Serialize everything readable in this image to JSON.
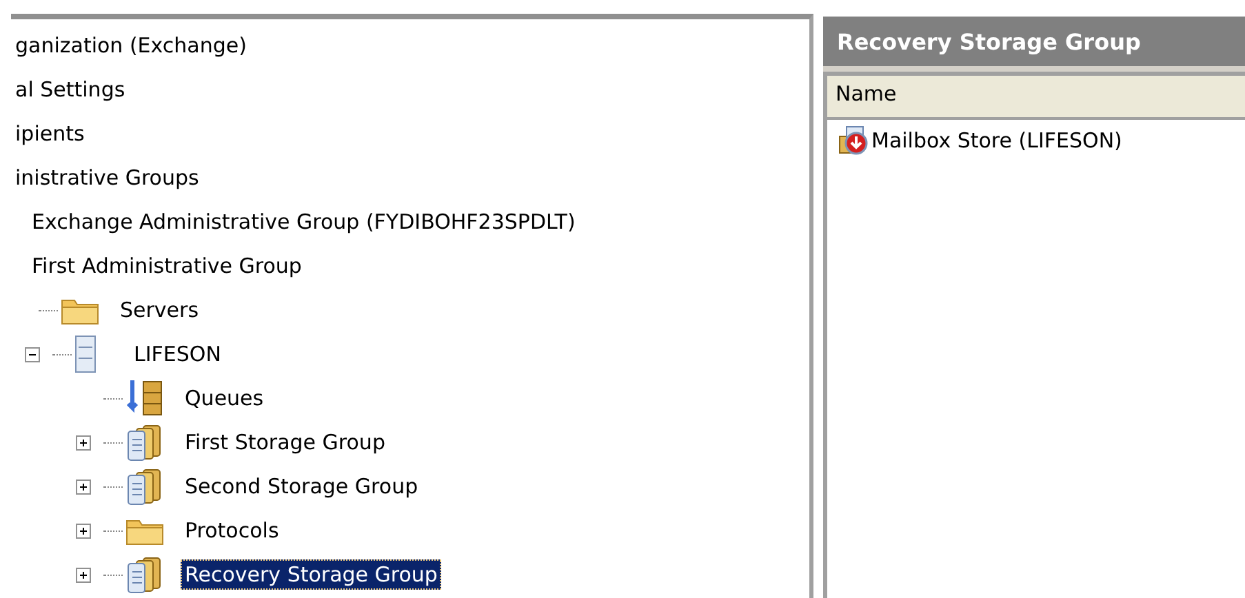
{
  "tree": [
    {
      "label": "ganization (Exchange)",
      "children": [
        {
          "label": "al Settings"
        },
        {
          "label": "ipients"
        },
        {
          "label": "inistrative Groups",
          "children": [
            {
              "label": "Exchange Administrative Group (FYDIBOHF23SPDLT)"
            },
            {
              "label": "First Administrative Group",
              "children": [
                {
                  "label": "Servers",
                  "kind": "folder",
                  "children": [
                    {
                      "label": "LIFESON",
                      "kind": "server",
                      "expanded": true,
                      "children": [
                        {
                          "label": "Queues",
                          "kind": "queue"
                        },
                        {
                          "label": "First Storage Group",
                          "kind": "storage",
                          "expanded": false,
                          "selected": false
                        },
                        {
                          "label": "Second Storage Group",
                          "kind": "storage",
                          "expanded": false,
                          "selected": false
                        },
                        {
                          "label": "Protocols",
                          "kind": "folder",
                          "expanded": false,
                          "selected": false
                        },
                        {
                          "label": "Recovery Storage Group",
                          "kind": "storage",
                          "expanded": false,
                          "selected": true
                        }
                      ]
                    }
                  ]
                }
              ]
            }
          ]
        }
      ]
    }
  ],
  "details": {
    "title": "Recovery Storage Group",
    "columns": [
      "Name"
    ],
    "rows": [
      {
        "name": "Mailbox Store (LIFESON)",
        "kind": "mailbox-store"
      }
    ]
  }
}
